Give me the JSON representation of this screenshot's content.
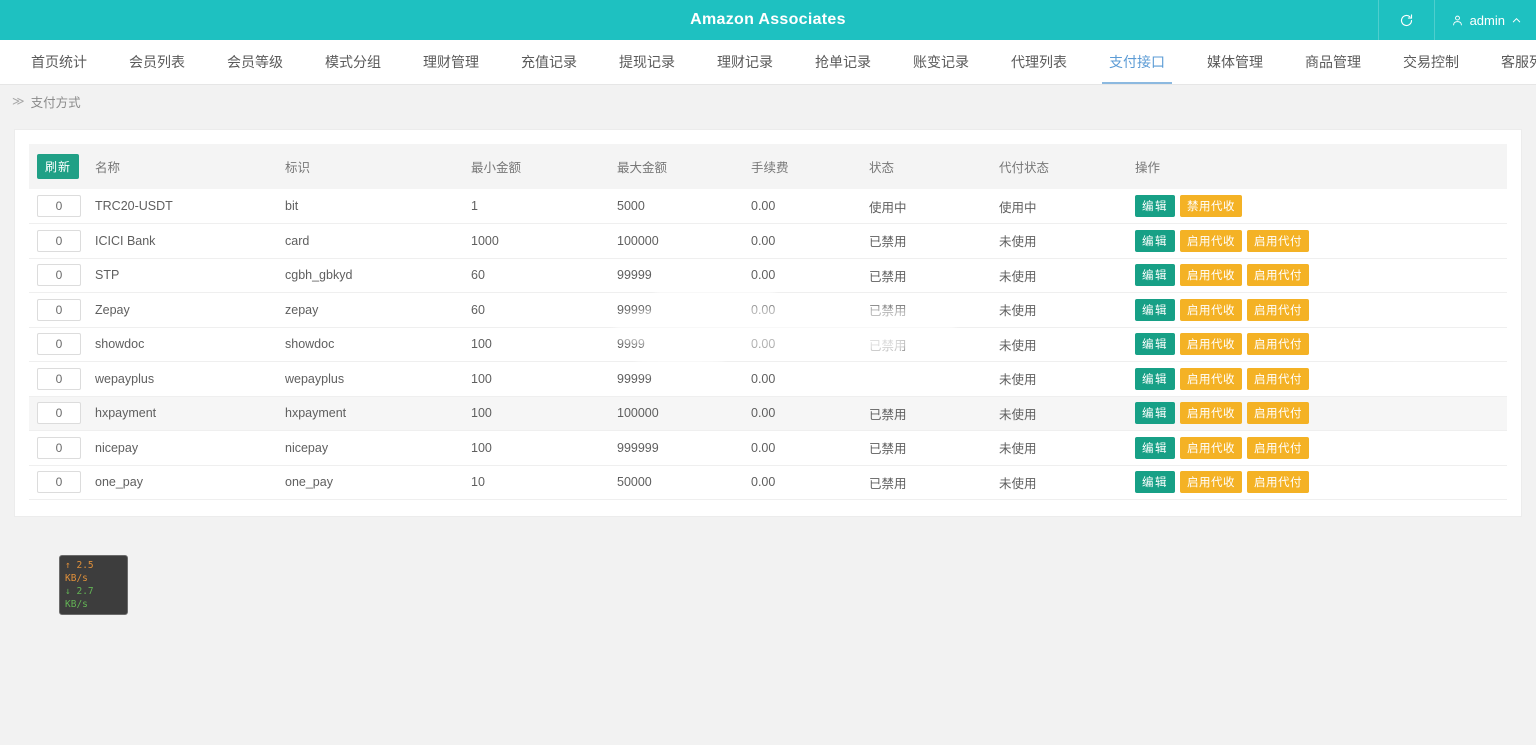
{
  "topbar": {
    "title": "Amazon Associates",
    "refresh_icon": "refresh-icon",
    "user_icon": "user-icon",
    "user_label": "admin",
    "caret_icon": "chevron-up-icon",
    "bg_color": "#1ec1c1"
  },
  "nav": {
    "items": [
      {
        "label": "首页统计",
        "active": false
      },
      {
        "label": "会员列表",
        "active": false
      },
      {
        "label": "会员等级",
        "active": false
      },
      {
        "label": "模式分组",
        "active": false
      },
      {
        "label": "理财管理",
        "active": false
      },
      {
        "label": "充值记录",
        "active": false
      },
      {
        "label": "提现记录",
        "active": false
      },
      {
        "label": "理财记录",
        "active": false
      },
      {
        "label": "抢单记录",
        "active": false
      },
      {
        "label": "账变记录",
        "active": false
      },
      {
        "label": "代理列表",
        "active": false
      },
      {
        "label": "支付接口",
        "active": true
      },
      {
        "label": "媒体管理",
        "active": false
      },
      {
        "label": "商品管理",
        "active": false
      },
      {
        "label": "交易控制",
        "active": false
      },
      {
        "label": "客服列表",
        "active": false
      }
    ],
    "active_color": "#5b9bd5"
  },
  "breadcrumb": {
    "separator": "≫",
    "current": "支付方式"
  },
  "table": {
    "refresh_label": "刷新",
    "headers": {
      "name": "名称",
      "key": "标识",
      "min": "最小金额",
      "max": "最大金额",
      "fee": "手续费",
      "status": "状态",
      "payout_status": "代付状态",
      "ops": "操作"
    },
    "status_on_text": "使用中",
    "status_off_text": "已禁用",
    "payout_on_text": "使用中",
    "payout_off_text": "未使用",
    "status_on_color": "#4bb96a",
    "status_off_color": "#e8857f",
    "btn_edit": "编辑",
    "btn_disable_collect": "禁用代收",
    "btn_enable_collect": "启用代收",
    "btn_enable_payout": "启用代付",
    "btn_edit_color": "#17a086",
    "btn_warn_color": "#f4b225",
    "rows": [
      {
        "idx": "0",
        "name": "TRC20-USDT",
        "key": "bit",
        "min": "1",
        "max": "5000",
        "fee": "0.00",
        "status": "使用中",
        "status_state": "on",
        "payout": "使用中",
        "payout_state": "on",
        "ops": [
          "编辑",
          "禁用代收"
        ],
        "highlight": false
      },
      {
        "idx": "0",
        "name": "ICICI Bank",
        "key": "card",
        "min": "1000",
        "max": "100000",
        "fee": "0.00",
        "status": "已禁用",
        "status_state": "off",
        "payout": "未使用",
        "payout_state": "off",
        "ops": [
          "编辑",
          "启用代收",
          "启用代付"
        ],
        "highlight": false
      },
      {
        "idx": "0",
        "name": "STP",
        "key": "cgbh_gbkyd",
        "min": "60",
        "max": "99999",
        "fee": "0.00",
        "status": "已禁用",
        "status_state": "off",
        "payout": "未使用",
        "payout_state": "off",
        "ops": [
          "编辑",
          "启用代收",
          "启用代付"
        ],
        "highlight": false
      },
      {
        "idx": "0",
        "name": "Zepay",
        "key": "zepay",
        "min": "60",
        "max": "99999",
        "fee": "0.00",
        "status": "已禁用",
        "status_state": "off",
        "payout": "未使用",
        "payout_state": "off",
        "ops": [
          "编辑",
          "启用代收",
          "启用代付"
        ],
        "highlight": false
      },
      {
        "idx": "0",
        "name": "showdoc",
        "key": "showdoc",
        "min": "100",
        "max": "9999",
        "fee": "0.00",
        "status": "已禁用",
        "status_state": "off",
        "payout": "未使用",
        "payout_state": "off",
        "ops": [
          "编辑",
          "启用代收",
          "启用代付"
        ],
        "highlight": false
      },
      {
        "idx": "0",
        "name": "wepayplus",
        "key": "wepayplus",
        "min": "100",
        "max": "99999",
        "fee": "0.00",
        "status": "",
        "status_state": "off",
        "payout": "未使用",
        "payout_state": "off",
        "ops": [
          "编辑",
          "启用代收",
          "启用代付"
        ],
        "highlight": false
      },
      {
        "idx": "0",
        "name": "hxpayment",
        "key": "hxpayment",
        "min": "100",
        "max": "100000",
        "fee": "0.00",
        "status": "已禁用",
        "status_state": "off",
        "payout": "未使用",
        "payout_state": "off",
        "ops": [
          "编辑",
          "启用代收",
          "启用代付"
        ],
        "highlight": true
      },
      {
        "idx": "0",
        "name": "nicepay",
        "key": "nicepay",
        "min": "100",
        "max": "999999",
        "fee": "0.00",
        "status": "已禁用",
        "status_state": "off",
        "payout": "未使用",
        "payout_state": "off",
        "ops": [
          "编辑",
          "启用代收",
          "启用代付"
        ],
        "highlight": false
      },
      {
        "idx": "0",
        "name": "one_pay",
        "key": "one_pay",
        "min": "10",
        "max": "50000",
        "fee": "0.00",
        "status": "已禁用",
        "status_state": "off",
        "payout": "未使用",
        "payout_state": "off",
        "ops": [
          "编辑",
          "启用代收",
          "启用代付"
        ],
        "highlight": false
      }
    ]
  },
  "netspeed": {
    "up_arrow": "↑",
    "up": "2.5 KB/s",
    "down_arrow": "↓",
    "down": "2.7 KB/s",
    "up_color": "#e0903a",
    "down_color": "#63b455"
  }
}
